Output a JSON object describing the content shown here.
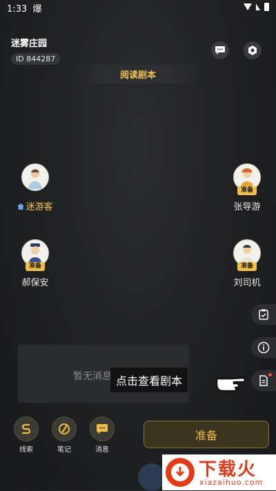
{
  "status_bar": {
    "time": "1:33",
    "carrier_icon": "爆"
  },
  "header": {
    "room_name": "迷雾庄园",
    "room_id": "ID 844287",
    "read_script_label": "阅读剧本",
    "chat_icon": "chat-bubble-icon",
    "settings_icon": "gear-icon"
  },
  "players": [
    {
      "name": "迷游客",
      "ready_label": "",
      "is_self": true
    },
    {
      "name": "张导游",
      "ready_label": "准备",
      "is_self": false
    },
    {
      "name": "郝保安",
      "ready_label": "准备",
      "is_self": false
    },
    {
      "name": "刘司机",
      "ready_label": "准备",
      "is_self": false
    }
  ],
  "side_buttons": [
    "clipboard-check-icon",
    "info-icon",
    "document-icon"
  ],
  "message_panel": {
    "empty_text": "暂无消息通知"
  },
  "tooltip": {
    "text": "点击查看剧本"
  },
  "bottom_bar": {
    "tools": [
      {
        "label": "线索",
        "icon": "clue-icon"
      },
      {
        "label": "笔记",
        "icon": "note-icon"
      },
      {
        "label": "消息",
        "icon": "message-icon"
      }
    ],
    "ready_button": "准备"
  },
  "watermark": {
    "title": "下载火",
    "url": "xiazaihuo.com"
  },
  "colors": {
    "accent": "#f2c045",
    "background": "#1e1f21"
  }
}
